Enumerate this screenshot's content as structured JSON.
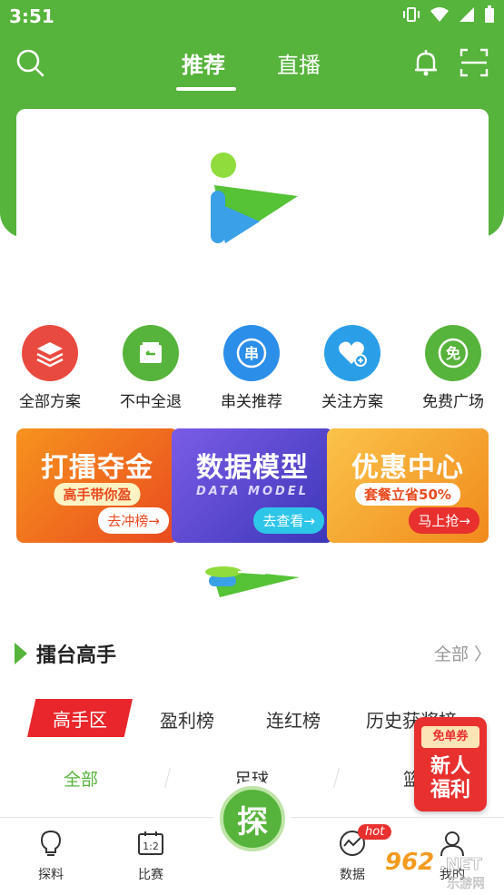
{
  "status": {
    "time": "3:51"
  },
  "nav": {
    "tabs": [
      {
        "label": "推荐"
      },
      {
        "label": "直播"
      }
    ],
    "icons": {
      "search": "search-icon",
      "bell": "bell-icon",
      "scan": "scan-icon"
    }
  },
  "colors": {
    "brand_green": "#56b33b",
    "accent_red": "#e8262b"
  },
  "quick_actions": [
    {
      "label": "全部方案",
      "icon": "layers-icon",
      "color": "#e94a3f"
    },
    {
      "label": "不中全退",
      "icon": "refund-icon",
      "color": "#56b33b"
    },
    {
      "label": "串关推荐",
      "icon": "parlay-icon",
      "color": "#2b8ee8"
    },
    {
      "label": "关注方案",
      "icon": "heart-plus-icon",
      "color": "#2b9ee8"
    },
    {
      "label": "免费广场",
      "icon": "free-icon",
      "color": "#56b33b"
    }
  ],
  "promos": [
    {
      "title": "打擂夺金",
      "subtitle": "高手带你盈",
      "button": "去冲榜→",
      "color": "#f07a1c"
    },
    {
      "title": "数据模型",
      "subtitle": "DATA MODEL",
      "button": "去查看→",
      "color": "#5b45c9"
    },
    {
      "title": "优惠中心",
      "subtitle": "套餐立省50%",
      "button": "马上抢→",
      "color": "#f5a623"
    }
  ],
  "section": {
    "title": "擂台高手",
    "all_label": "全部 〉"
  },
  "rank_tabs": [
    {
      "label": "高手区"
    },
    {
      "label": "盈利榜"
    },
    {
      "label": "连红榜"
    },
    {
      "label": "历史获奖榜"
    }
  ],
  "sport_tabs": [
    {
      "label": "全部"
    },
    {
      "label": "足球"
    },
    {
      "label": "篮"
    }
  ],
  "coupon": {
    "top": "免单券",
    "line1": "新人",
    "line2": "福利"
  },
  "tabbar": [
    {
      "label": "探料",
      "icon": "bulb-icon"
    },
    {
      "label": "比赛",
      "icon": "scoreboard-icon"
    },
    {
      "label": "探",
      "icon": "explore-center-icon"
    },
    {
      "label": "数据",
      "icon": "chart-icon"
    },
    {
      "label": "我的",
      "icon": "user-icon"
    }
  ],
  "hot_badge": "hot",
  "watermark": "962.NET 乐游网"
}
